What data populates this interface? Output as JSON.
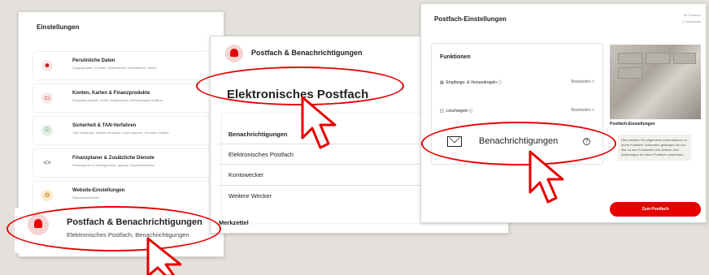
{
  "panel1": {
    "title": "Einstellungen",
    "cards": [
      {
        "title": "Persönliche Daten",
        "subtitle": "Zugangsdaten, Kontakt, Datenschutz, Vollmachten, Steuer",
        "icon": "person-icon"
      },
      {
        "title": "Konten, Karten & Finanzprodukte",
        "subtitle": "Dispositionskredit, Limits, Multibanking, Kleinanzeigen eröffnen",
        "icon": "card-icon"
      },
      {
        "title": "Sicherheit & TAN-Verfahren",
        "subtitle": "TAN-Verfahren, Geräte verwalten, Konto sperren, Schaden melden",
        "icon": "shield-icon"
      },
      {
        "title": "Finanzplaner & Zusätzliche Dienste",
        "subtitle": "Finanzplaner & Vertragscheck, giropay, Zusatzfunktionen",
        "icon": "code-icon"
      },
      {
        "title": "Website-Einstellungen",
        "subtitle": "Standardansichten",
        "icon": "gear-icon"
      }
    ],
    "highlight": {
      "title": "Postfach & Benachrichtigungen",
      "subtitle": "Elektronisches Postfach, Benachrichtigungen"
    }
  },
  "panel2": {
    "title": "Postfach & Benachrichtigungen",
    "big": "Elektronisches Postfach",
    "rows": [
      "Benachrichtigungen",
      "Elektronisches Postfach",
      "Kontowecker",
      "Weitere Wecker"
    ],
    "footer": "Merkzettel"
  },
  "panel3": {
    "title": "Postfach-Einstellungen",
    "top_right": "Ihr Postfach",
    "merkzettel": "Merkzettel",
    "functions_title": "Funktionen",
    "functions": [
      {
        "label": "Empfangs- & Versandregeln ⓘ",
        "action": "Bearbeiten  >"
      },
      {
        "label": "Löschregeln ⓘ",
        "action": "Bearbeiten  >"
      }
    ],
    "card_title": "Postfach-Einstellungen",
    "card_text": "Hier erhalten Sie allgemeine Informationen zu Ihrem Postfach. Außerdem gelangen Sie von hier zu den Funktionen und können dort Änderungen an Ihrem Postfach vornehmen.",
    "button": "Zum Postfach"
  },
  "notif": {
    "label": "Benachrichtigungen",
    "help": "?"
  },
  "colors": {
    "accent": "#e60000",
    "background": "#e4e1dc"
  }
}
